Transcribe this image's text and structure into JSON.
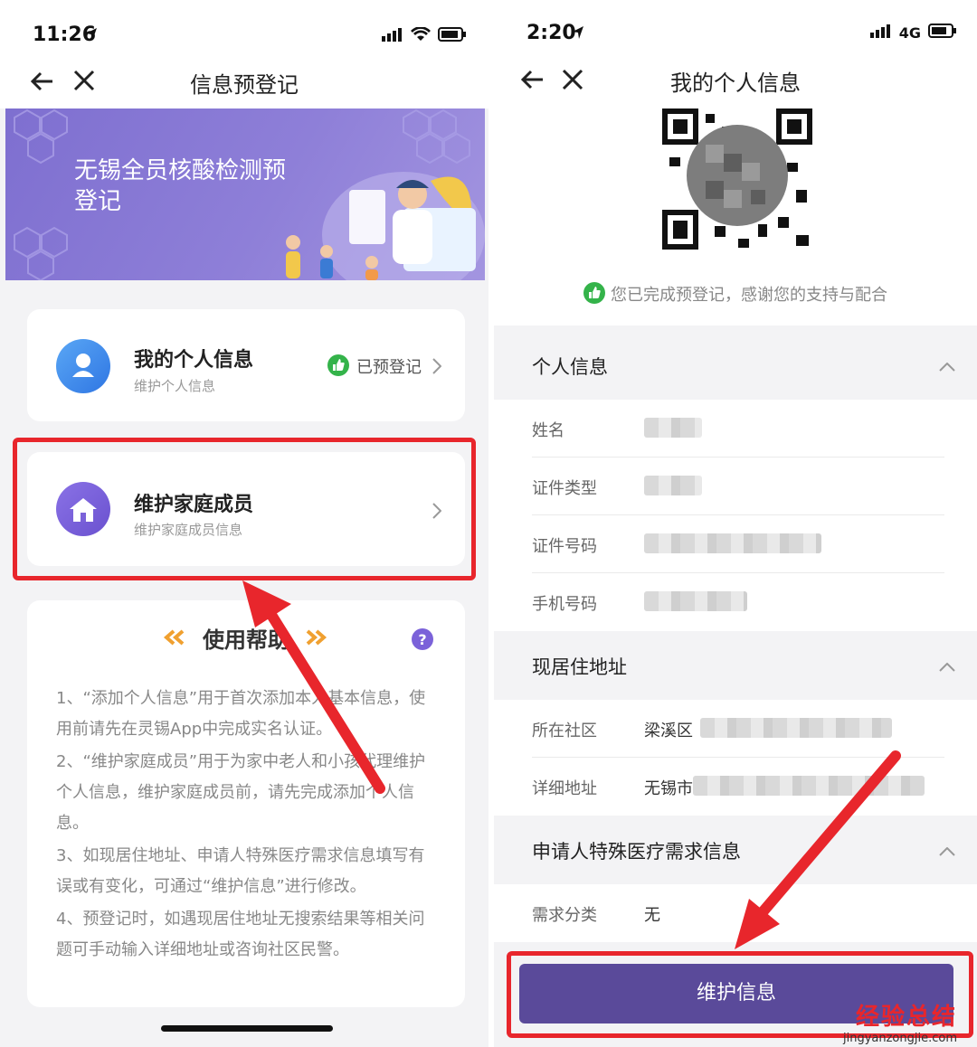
{
  "left": {
    "status_time": "11:26",
    "nav_title": "信息预登记",
    "banner_title": "无锡全员核酸检测预登记",
    "card_personal": {
      "title": "我的个人信息",
      "subtitle": "维护个人信息",
      "status": "已预登记"
    },
    "card_family": {
      "title": "维护家庭成员",
      "subtitle": "维护家庭成员信息"
    },
    "help": {
      "title": "使用帮助",
      "items": [
        "1、“添加个人信息”用于首次添加本人基本信息，使用前请先在灵锡App中完成实名认证。",
        "2、“维护家庭成员”用于为家中老人和小孩代理维护个人信息，维护家庭成员前，请先完成添加个人信息。",
        "3、如现居住地址、申请人特殊医疗需求信息填写有误或有变化，可通过“维护信息”进行修改。",
        "4、预登记时，如遇现居住地址无搜索结果等相关问题可手动输入详细地址或咨询社区民警。"
      ]
    }
  },
  "right": {
    "status_time": "2:20",
    "network": "4G",
    "nav_title": "我的个人信息",
    "success_msg": "您已完成预登记，感谢您的支持与配合",
    "sections": {
      "personal": "个人信息",
      "address": "现居住地址",
      "medical": "申请人特殊医疗需求信息"
    },
    "fields": {
      "name": "姓名",
      "id_type": "证件类型",
      "id_number": "证件号码",
      "phone": "手机号码",
      "community": "所在社区",
      "community_value": "梁溪区",
      "address": "详细地址",
      "address_value": "无锡市",
      "need": "需求分类",
      "need_value": "无"
    },
    "button": "维护信息"
  },
  "watermark": {
    "main": "经验总结",
    "sub": "jingyanzongjie.com"
  },
  "colors": {
    "accent": "#5a4a9a",
    "highlight": "#e8262c",
    "success": "#34b34a",
    "avatar_blue": "#3d8ef0",
    "avatar_purple": "#7b62d9"
  }
}
